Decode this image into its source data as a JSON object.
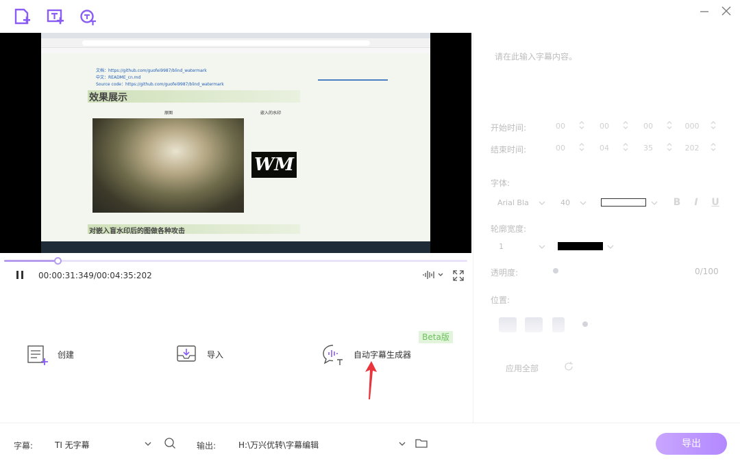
{
  "toolbar": {
    "icons": [
      "new-file-icon",
      "add-subtitle-icon",
      "auto-subtitle-icon"
    ]
  },
  "window_controls": [
    "minimize-icon",
    "close-icon"
  ],
  "preview": {
    "screen": {
      "bullets": [
        "文档：https://github.com/guofei9987/blind_watermark",
        "中文：README_cn.md",
        "Source code：https://github.com/guofei9987/blind_watermark"
      ],
      "heading": "效果展示",
      "col_left": "原图",
      "col_right": "嵌入的水印",
      "watermark": "WM",
      "heading2": "对嵌入盲水印后的图做各种攻击"
    }
  },
  "player": {
    "progress_fraction": 0.115,
    "timecode": "00:00:31:349/00:04:35:202"
  },
  "actions": {
    "create_label": "创建",
    "import_label": "导入",
    "auto_label": "自动字幕生成器",
    "beta": "Beta版"
  },
  "bottom": {
    "subtitle_label": "字幕:",
    "subtitle_value": "TI 无字幕",
    "output_label": "输出:",
    "output_path": "H:\\万兴优转\\字幕编辑",
    "export_label": "导出"
  },
  "right_panel": {
    "placeholder": "请在此输入字幕内容。",
    "start_label": "开始时间:",
    "end_label": "结束时间:",
    "start_time": [
      "00",
      "00",
      "00",
      "000"
    ],
    "end_time": [
      "00",
      "04",
      "35",
      "202"
    ],
    "font_label": "字体:",
    "font_name": "Arial Bla",
    "font_size": "40",
    "outline_label": "轮廓宽度:",
    "outline_value": "1",
    "opacity_label": "透明度:",
    "opacity_value": "0/100",
    "position_label": "位置:",
    "apply_all": "应用全部",
    "style_buttons": [
      "B",
      "I",
      "U"
    ]
  },
  "colors": {
    "accent": "#b388ff",
    "beta_bg": "#e2f5dc",
    "beta_text": "#6cc15b",
    "arrow": "#e8343a"
  }
}
